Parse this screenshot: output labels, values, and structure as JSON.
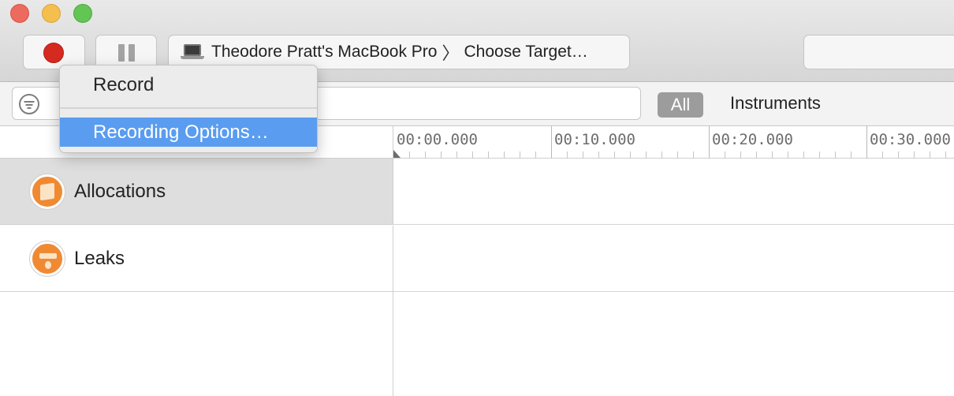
{
  "toolbar": {
    "target_device": "Theodore Pratt's MacBook Pro",
    "target_separator": "〉",
    "target_choose": "Choose Target…"
  },
  "menu": {
    "items": [
      {
        "label": "Record"
      },
      {
        "label": "Recording Options…"
      }
    ],
    "highlight_color": "#5a9cf0"
  },
  "filter": {
    "scope_all": "All",
    "scope_instruments": "Instruments"
  },
  "timeline": {
    "labels": [
      "00:00.000",
      "00:10.000",
      "00:20.000",
      "00:30.000"
    ]
  },
  "instruments": [
    {
      "name": "Allocations",
      "icon": "allocations-cube-icon",
      "selected": true
    },
    {
      "name": "Leaks",
      "icon": "leaks-faucet-icon",
      "selected": false
    }
  ],
  "colors": {
    "record": "#d52a20",
    "instrument_icon": "#ef8a33",
    "scope_selected": "#9c9c9c"
  }
}
